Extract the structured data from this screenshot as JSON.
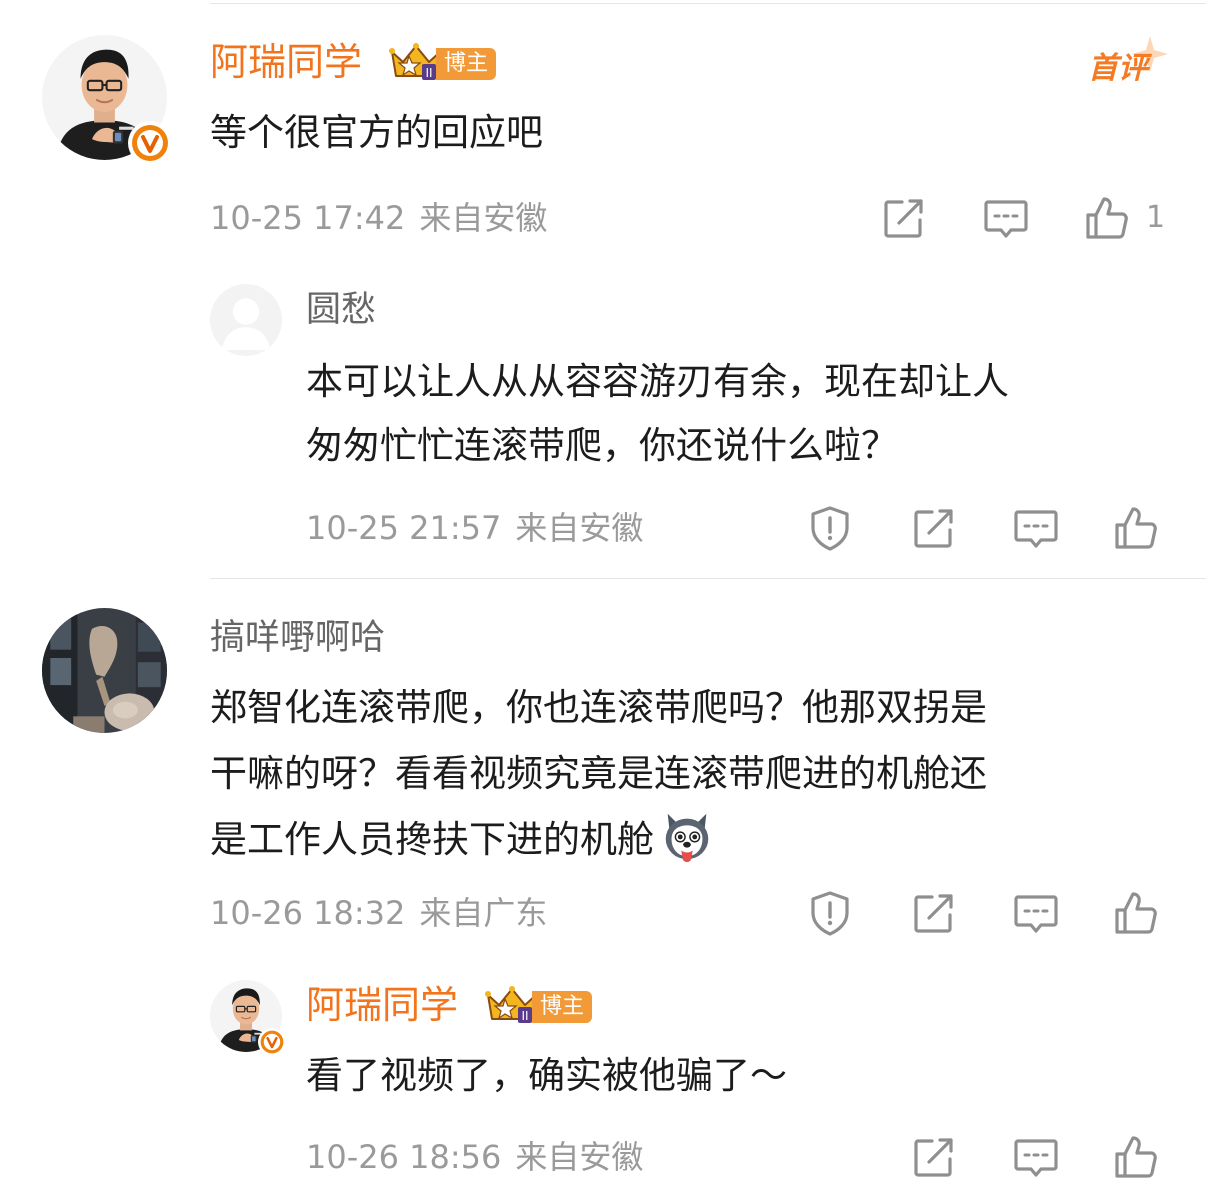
{
  "comments": [
    {
      "author": "阿瑞同学",
      "badge": "博主",
      "first_comment_tag": "首评",
      "text": "等个很官方的回应吧",
      "time": "10-25 17:42",
      "location": "来自安徽",
      "like_count": "1",
      "reply": {
        "author": "圆愁",
        "lines": [
          "本可以让人从从容容游刃有余，现在却让人",
          "匆匆忙忙连滚带爬，你还说什么啦？"
        ],
        "time": "10-25 21:57",
        "location": "来自安徽"
      }
    },
    {
      "author": "搞咩嘢啊哈",
      "lines": [
        "郑智化连滚带爬，你也连滚带爬吗？他那双拐是",
        "干嘛的呀？看看视频究竟是连滚带爬进的机舱还",
        "是工作人员搀扶下进的机舱"
      ],
      "time": "10-26 18:32",
      "location": "来自广东",
      "reply": {
        "author": "阿瑞同学",
        "badge": "博主",
        "text": "看了视频了，确实被他骗了～",
        "time": "10-26 18:56",
        "location": "来自安徽"
      }
    }
  ],
  "colors": {
    "author_orange": "#f2741d",
    "badge_bg": "#f29a38",
    "verified": "#f0820c",
    "meta_gray": "#9a9a9a",
    "icon_gray": "#8f8f8f"
  },
  "icons": [
    "report-icon",
    "repost-icon",
    "comment-icon",
    "like-icon",
    "verified-v-icon",
    "crown-level-icon",
    "husky-emoji-icon"
  ]
}
